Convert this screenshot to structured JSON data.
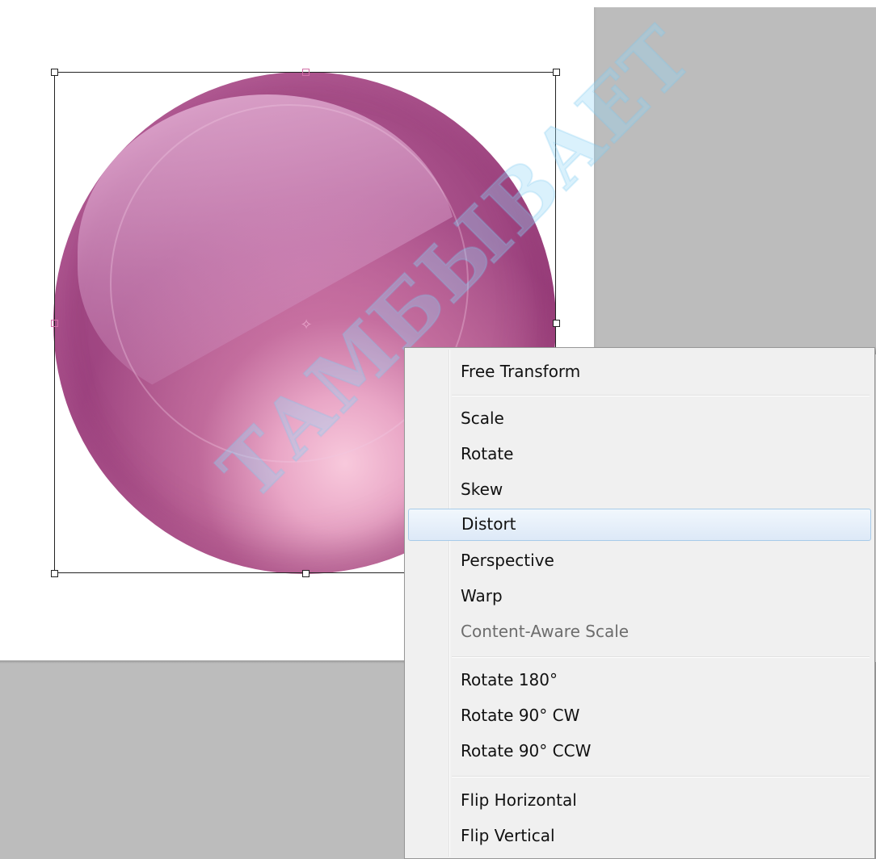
{
  "context_menu": {
    "groups": [
      [
        "Free Transform"
      ],
      [
        "Scale",
        "Rotate",
        "Skew",
        "Distort",
        "Perspective",
        "Warp",
        "Content-Aware Scale"
      ],
      [
        "Rotate 180°",
        "Rotate 90° CW",
        "Rotate 90° CCW"
      ],
      [
        "Flip Horizontal",
        "Flip Vertical"
      ]
    ],
    "items": {
      "free_transform": "Free Transform",
      "scale": "Scale",
      "rotate": "Rotate",
      "skew": "Skew",
      "distort": "Distort",
      "perspective": "Perspective",
      "warp": "Warp",
      "content_aware_scale": "Content-Aware Scale",
      "rotate_180": "Rotate 180°",
      "rotate_90_cw": "Rotate 90° CW",
      "rotate_90_ccw": "Rotate 90° CCW",
      "flip_horizontal": "Flip Horizontal",
      "flip_vertical": "Flip Vertical"
    },
    "hovered_item": "Distort",
    "disabled_items": [
      "Content-Aware Scale"
    ]
  },
  "canvas": {
    "object": "glossy-pink-sphere",
    "sphere_color": "#a44c86",
    "highlight_color": "#f8c9dc",
    "pasteboard_color": "#bcbcbc",
    "center_marker_icon": "reference-point-icon"
  },
  "watermark": {
    "text": "ТАМБЫВАЕТ",
    "color": "#96d7f5"
  }
}
